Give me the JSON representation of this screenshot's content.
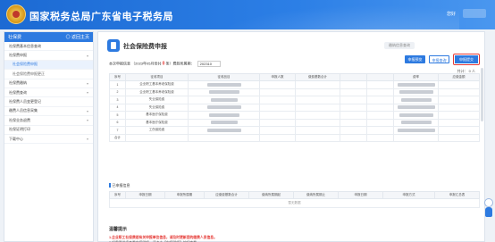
{
  "header": {
    "site_title": "国家税务总局广东省电子税务局",
    "user_greeting": "您好",
    "brand_color": "#2d7ae0"
  },
  "sidebar": {
    "title": "社保费",
    "back_label": "◎ 返回主页",
    "items": [
      {
        "label": "社保费基本信息查询",
        "sub": false,
        "active": false,
        "expandable": false
      },
      {
        "label": "社保费申报",
        "sub": false,
        "active": false,
        "expandable": true
      },
      {
        "label": "社会保险费申报",
        "sub": true,
        "active": true,
        "expandable": false
      },
      {
        "label": "社会保险费申报更正",
        "sub": true,
        "active": false,
        "expandable": false
      },
      {
        "label": "社保费缴纳",
        "sub": false,
        "active": false,
        "expandable": true
      },
      {
        "label": "社保费查询",
        "sub": false,
        "active": false,
        "expandable": true
      },
      {
        "label": "社保费人员变更登记",
        "sub": false,
        "active": false,
        "expandable": false
      },
      {
        "label": "缴费人员信息采集",
        "sub": false,
        "active": false,
        "expandable": true
      },
      {
        "label": "社保业务退费",
        "sub": false,
        "active": false,
        "expandable": true
      },
      {
        "label": "社保证明打印",
        "sub": false,
        "active": false,
        "expandable": false
      },
      {
        "label": "下载中心",
        "sub": false,
        "active": false,
        "expandable": true
      }
    ]
  },
  "page": {
    "title": "社会保险费申报",
    "top_right_label": "缴纳信息查询",
    "buttons": {
      "preview": "申报预览",
      "query": "申报查询",
      "submit": "申报提交"
    },
    "filter_label": "本次申报信息",
    "filter_text_1": "（2023年05月份共",
    "filter_count": "0",
    "filter_text_2": "条）费款所属期：",
    "period_value": "202310",
    "count_label": "共计：",
    "count_value": "0",
    "count_unit": "人"
  },
  "table1": {
    "headers": [
      "序号",
      "征收项目",
      "征收品目",
      "申报人数",
      "缴费基数合计",
      "",
      "",
      "费率",
      "应缴金额"
    ],
    "rows": [
      [
        "1",
        "企业职工基本养老保险费",
        "",
        "",
        "",
        "",
        "",
        "",
        ""
      ],
      [
        "2",
        "企业职工基本养老保险费",
        "",
        "",
        "",
        "",
        "",
        "",
        ""
      ],
      [
        "3",
        "失业保险费",
        "",
        "",
        "",
        "",
        "",
        "",
        ""
      ],
      [
        "4",
        "失业保险费",
        "",
        "",
        "",
        "",
        "",
        "",
        ""
      ],
      [
        "5",
        "基本医疗保险费",
        "",
        "",
        "",
        "",
        "",
        "",
        ""
      ],
      [
        "6",
        "基本医疗保险费",
        "",
        "",
        "",
        "",
        "",
        "",
        ""
      ],
      [
        "7",
        "工伤保险费",
        "",
        "",
        "",
        "",
        "",
        "",
        ""
      ]
    ],
    "total_label": "合计"
  },
  "section2": {
    "title": "已申报信息",
    "headers": [
      "序号",
      "申报日期",
      "申报所属期",
      "应缴费基数合计",
      "缴纳所属期起",
      "缴纳所属期止",
      "申报日期",
      "申报方式",
      "申报汇总表"
    ],
    "empty_text": "暂无数据"
  },
  "hint": {
    "title": "温馨提示",
    "lines": [
      {
        "text": "1.企业职工社保费若有关申报单位信息，请及时更新您的缴费人员信息。",
        "red": true
      },
      {
        "text": "2.如需要继续查看申报明细，请点击【申报明细】按钮查看。",
        "red": false
      },
      {
        "text": "3.如需缴纳本期社保费，请在申报成功后点击缴纳按钮进行缴款。",
        "red": false
      }
    ]
  }
}
